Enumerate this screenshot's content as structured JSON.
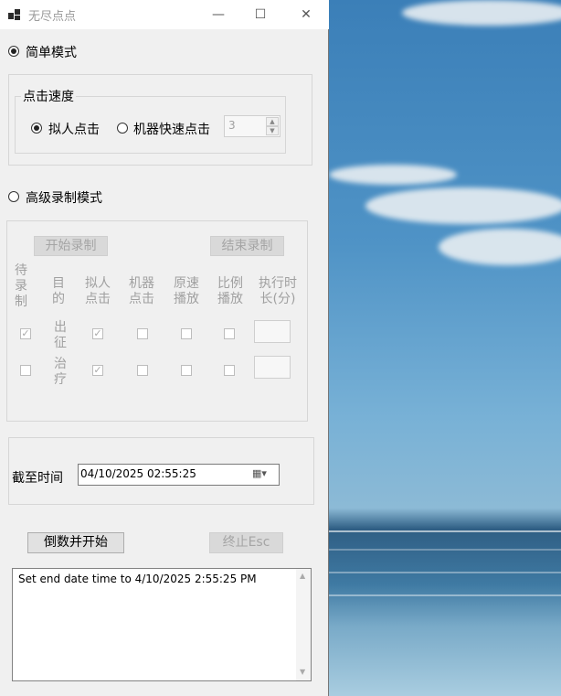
{
  "window": {
    "title": "无尽点点",
    "minimize": "—",
    "maximize": "☐",
    "close": "✕"
  },
  "simple_mode": {
    "label": "简单模式",
    "selected": true,
    "speed_group": {
      "legend": "点击速度",
      "human_click": "拟人点击",
      "human_selected": true,
      "machine_click": "机器快速点击",
      "machine_selected": false,
      "interval_value": "3"
    }
  },
  "advanced_mode": {
    "label": "高级录制模式",
    "selected": false,
    "start_record": "开始录制",
    "end_record": "结束录制",
    "columns": [
      {
        "line1": "待",
        "line2": "录",
        "line3": "制"
      },
      {
        "line1": "目",
        "line2": "的",
        "line3": ""
      },
      {
        "line1": "拟人",
        "line2": "点击",
        "line3": ""
      },
      {
        "line1": "机器",
        "line2": "点击",
        "line3": ""
      },
      {
        "line1": "原速",
        "line2": "播放",
        "line3": ""
      },
      {
        "line1": "比例",
        "line2": "播放",
        "line3": ""
      },
      {
        "line1": "执行时",
        "line2": "长(分)",
        "line3": ""
      }
    ],
    "rows": [
      {
        "target_line1": "出",
        "target_line2": "征",
        "record": true,
        "human": true,
        "machine": false,
        "original": false,
        "ratio": false,
        "duration": ""
      },
      {
        "target_line1": "治",
        "target_line2": "疗",
        "record": false,
        "human": true,
        "machine": false,
        "original": false,
        "ratio": false,
        "duration": ""
      }
    ]
  },
  "deadline": {
    "label": "截至时间",
    "value": "04/10/2025 02:55:25"
  },
  "actions": {
    "start": "倒数并开始",
    "stop": "终止Esc"
  },
  "log": {
    "text": "Set end date time to 4/10/2025 2:55:25 PM"
  },
  "icons": [
    "app-icon",
    "minimize-icon",
    "maximize-icon",
    "close-icon",
    "calendar-icon",
    "spin-up-icon",
    "spin-down-icon",
    "scroll-up-icon",
    "scroll-down-icon"
  ]
}
